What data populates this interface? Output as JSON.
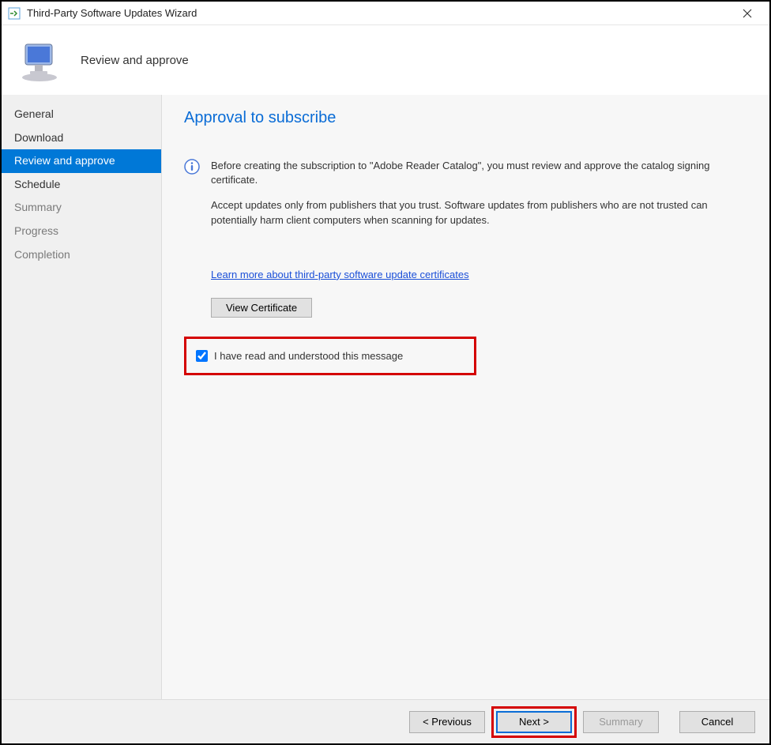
{
  "window": {
    "title": "Third-Party Software Updates Wizard"
  },
  "header": {
    "title": "Review and approve"
  },
  "sidebar": {
    "items": [
      {
        "label": "General",
        "state": "normal"
      },
      {
        "label": "Download",
        "state": "normal"
      },
      {
        "label": "Review and approve",
        "state": "selected"
      },
      {
        "label": "Schedule",
        "state": "normal"
      },
      {
        "label": "Summary",
        "state": "disabled"
      },
      {
        "label": "Progress",
        "state": "disabled"
      },
      {
        "label": "Completion",
        "state": "disabled"
      }
    ]
  },
  "content": {
    "section_title": "Approval to subscribe",
    "info_para1": "Before creating the subscription to \"Adobe Reader Catalog\", you must review and approve the catalog signing certificate.",
    "info_para2": "Accept updates only from publishers that you trust. Software updates from publishers who are not trusted can potentially harm client computers when scanning for updates.",
    "learn_more": "Learn more about third-party software update certificates",
    "view_cert_label": "View Certificate",
    "checkbox_label": "I have read and understood this message",
    "checkbox_checked": true
  },
  "footer": {
    "previous": "< Previous",
    "next": "Next >",
    "summary": "Summary",
    "cancel": "Cancel"
  }
}
